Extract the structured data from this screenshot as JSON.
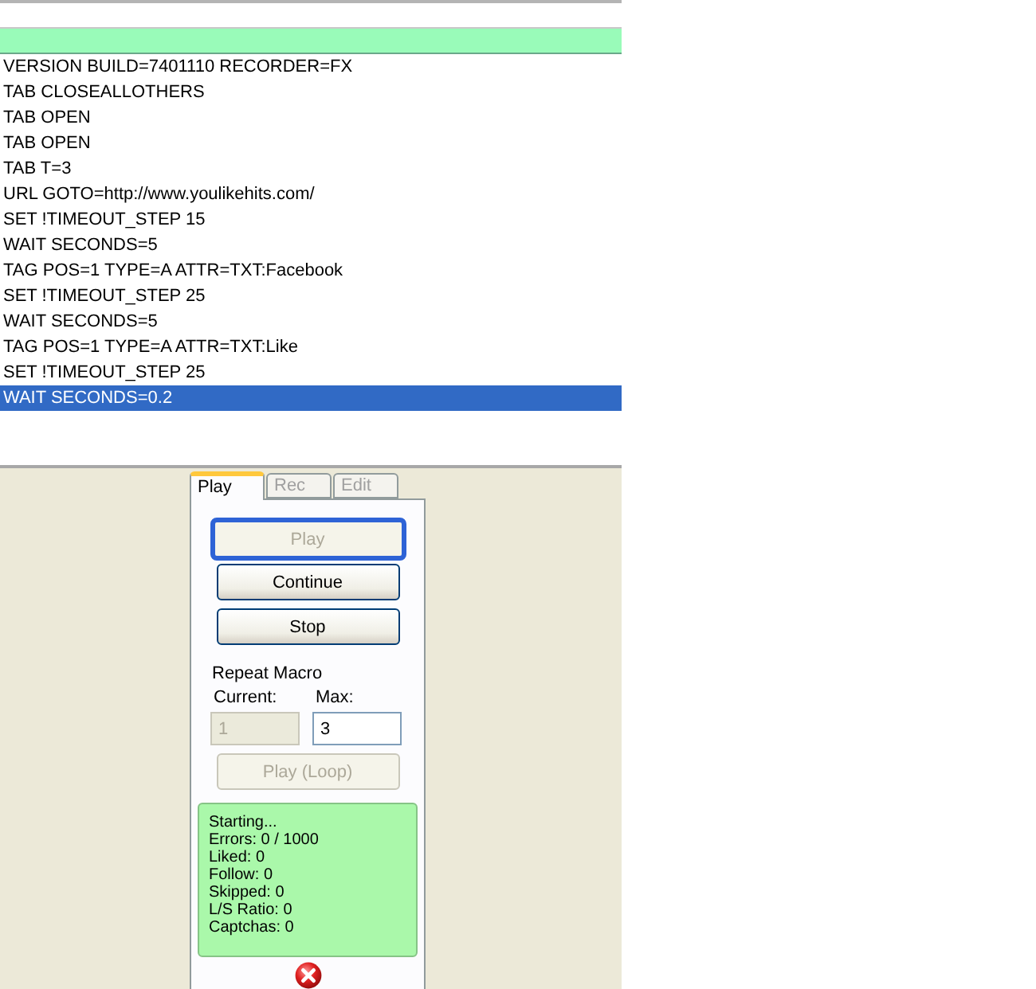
{
  "macro_editor": {
    "lines": [
      {
        "text": "VERSION BUILD=7401110 RECORDER=FX",
        "selected": false
      },
      {
        "text": "TAB CLOSEALLOTHERS",
        "selected": false
      },
      {
        "text": "TAB OPEN",
        "selected": false
      },
      {
        "text": "TAB OPEN",
        "selected": false
      },
      {
        "text": "TAB T=3",
        "selected": false
      },
      {
        "text": "URL GOTO=http://www.youlikehits.com/",
        "selected": false
      },
      {
        "text": "SET !TIMEOUT_STEP 15",
        "selected": false
      },
      {
        "text": "WAIT SECONDS=5",
        "selected": false
      },
      {
        "text": "TAG POS=1 TYPE=A ATTR=TXT:Facebook",
        "selected": false
      },
      {
        "text": "SET !TIMEOUT_STEP 25",
        "selected": false
      },
      {
        "text": "WAIT SECONDS=5",
        "selected": false
      },
      {
        "text": "TAG POS=1 TYPE=A ATTR=TXT:Like",
        "selected": false
      },
      {
        "text": "SET !TIMEOUT_STEP 25",
        "selected": false
      },
      {
        "text": "WAIT SECONDS=0.2",
        "selected": true
      }
    ]
  },
  "control_panel": {
    "tabs": [
      {
        "label": "Play",
        "selected": true,
        "disabled": false
      },
      {
        "label": "Rec",
        "selected": false,
        "disabled": true
      },
      {
        "label": "Edit",
        "selected": false,
        "disabled": true
      }
    ],
    "buttons": [
      {
        "label": "Play",
        "disabled": true,
        "focused": true
      },
      {
        "label": "Continue",
        "disabled": false,
        "focused": false
      },
      {
        "label": "Stop",
        "disabled": false,
        "focused": false
      }
    ],
    "repeat_macro": {
      "title": "Repeat Macro",
      "current": {
        "label": "Current:",
        "value": "1",
        "disabled": true
      },
      "max": {
        "label": "Max:",
        "value": "3",
        "disabled": false
      }
    },
    "loop_button": {
      "label": "Play (Loop)",
      "disabled": true
    },
    "status_lines": [
      "Starting...",
      "Errors: 0 / 1000",
      "Liked: 0",
      "Follow: 0",
      "Skipped: 0",
      "L/S Ratio: 0",
      "Captchas: 0"
    ]
  }
}
